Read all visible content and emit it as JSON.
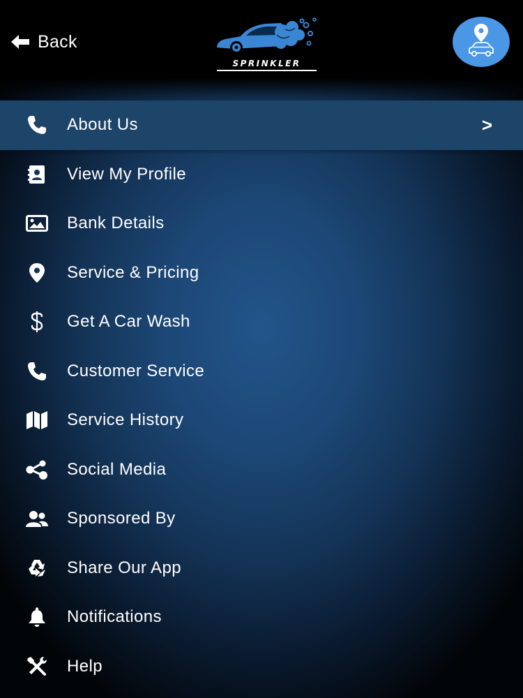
{
  "header": {
    "back_label": "Back",
    "logo_text": "SPRINKLER",
    "location_icon": "location-car-icon"
  },
  "menu": {
    "items": [
      {
        "label": "About Us",
        "icon": "phone-icon",
        "active": true,
        "chevron": ">"
      },
      {
        "label": "View My Profile",
        "icon": "contact-book-icon"
      },
      {
        "label": "Bank Details",
        "icon": "image-icon"
      },
      {
        "label": "Service & Pricing",
        "icon": "map-pin-icon"
      },
      {
        "label": "Get A Car Wash",
        "icon": "dollar-icon"
      },
      {
        "label": "Customer Service",
        "icon": "phone-icon"
      },
      {
        "label": "Service History",
        "icon": "map-icon"
      },
      {
        "label": "Social Media",
        "icon": "share-nodes-icon"
      },
      {
        "label": "Sponsored By",
        "icon": "users-icon"
      },
      {
        "label": "Share Our App",
        "icon": "recycle-icon"
      },
      {
        "label": "Notifications",
        "icon": "bell-icon"
      },
      {
        "label": "Help",
        "icon": "tools-icon"
      }
    ]
  },
  "colors": {
    "accent": "#4a97e6",
    "active_row": "#1d4469",
    "background_center": "#22558a",
    "header": "#000000",
    "text": "#ffffff"
  }
}
